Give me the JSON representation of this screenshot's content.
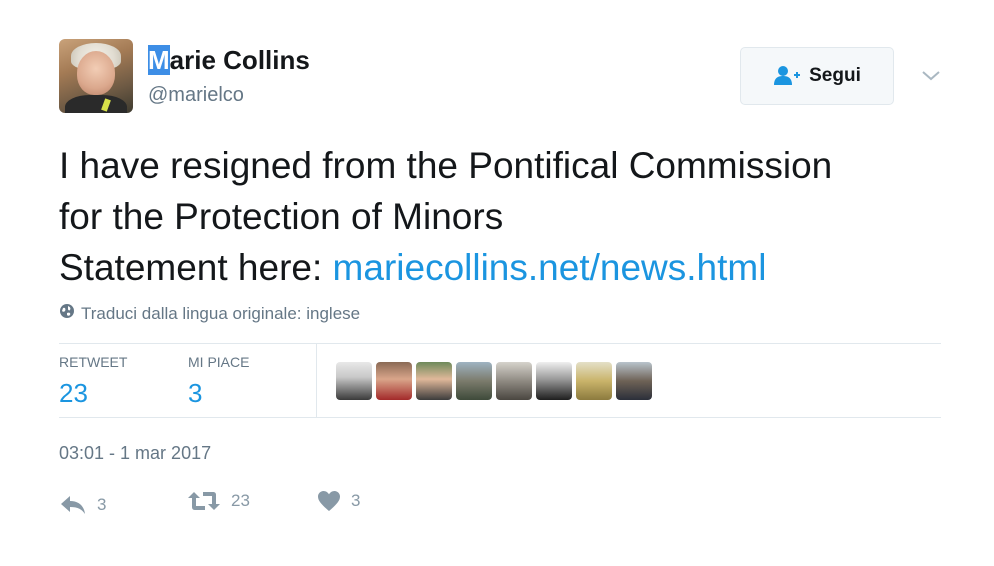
{
  "author": {
    "name_highlight": "M",
    "name_rest": "arie Collins",
    "handle": "@marielco"
  },
  "follow_button": {
    "label": "Segui",
    "icon": "add-user-icon"
  },
  "more_menu": {
    "icon": "chevron-down-icon"
  },
  "tweet": {
    "line1": "I have resigned from the Pontifical Commission",
    "line2": "for the Protection of Minors",
    "line3_prefix": "Statement here: ",
    "link": "mariecollins.net/news.html"
  },
  "translate": {
    "label": "Traduci dalla lingua originale: inglese",
    "icon": "globe-icon"
  },
  "stats": {
    "retweets_label": "RETWEET",
    "retweets_count": "23",
    "likes_label": "MI PIACE",
    "likes_count": "3"
  },
  "likers_count": 8,
  "timestamp": "03:01 - 1 mar 2017",
  "actions": {
    "reply_count": "3",
    "retweet_count": "23",
    "like_count": "3"
  },
  "colors": {
    "link": "#1b95e0",
    "muted": "#657786",
    "action_icon": "#8899a6",
    "name_highlight": "#3d8ee6"
  }
}
